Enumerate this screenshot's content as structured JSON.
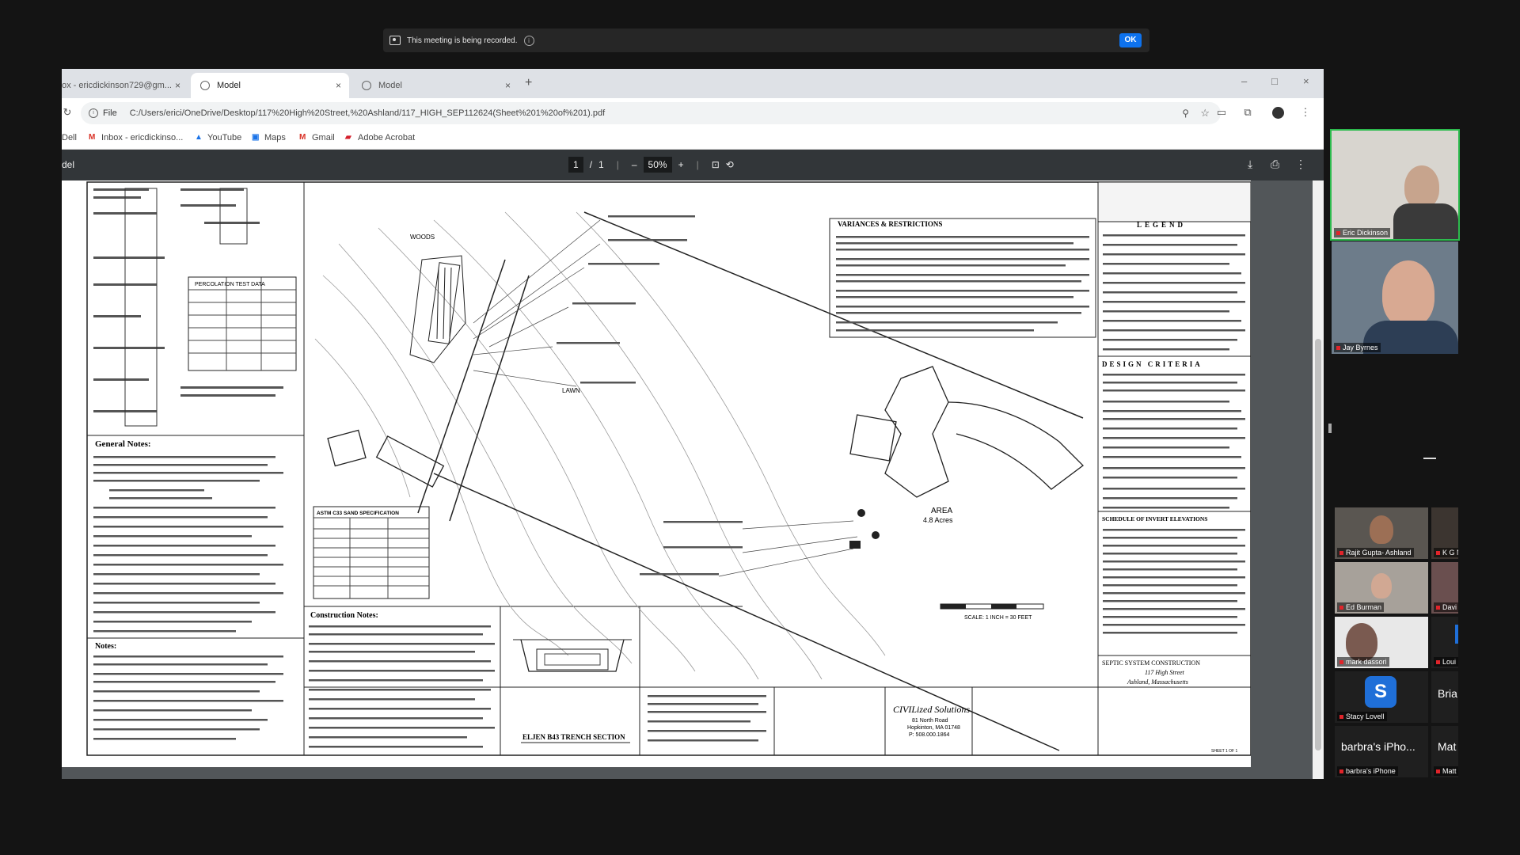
{
  "recording_banner": {
    "text": "This meeting is being recorded.",
    "info": "i",
    "ok_label": "OK"
  },
  "browser": {
    "tabs": [
      {
        "label": "ox - ericdickinson729@gm...",
        "close": "×"
      },
      {
        "label": "Model",
        "close": "×"
      },
      {
        "label": "Model",
        "close": "×"
      }
    ],
    "new_tab": "+",
    "window_controls": {
      "minimize": "–",
      "maximize": "□",
      "close": "×"
    },
    "address": {
      "scheme_label": "File",
      "url": "C:/Users/erici/OneDrive/Desktop/117%20High%20Street,%20Ashland/117_HIGH_SEP112624(Sheet%201%20of%201).pdf"
    },
    "bookmarks": [
      {
        "label": "Dell"
      },
      {
        "label": "Inbox - ericdickinso..."
      },
      {
        "label": "YouTube"
      },
      {
        "label": "Maps"
      },
      {
        "label": "Gmail"
      },
      {
        "label": "Adobe Acrobat"
      }
    ]
  },
  "pdf_viewer": {
    "title": "del",
    "page_current": "1",
    "page_separator": "/",
    "page_total": "1",
    "zoom": "50%",
    "zoom_out": "–",
    "zoom_in": "+"
  },
  "drawing": {
    "general_notes_title": "General Notes:",
    "notes_title": "Notes:",
    "construction_notes_title": "Construction Notes:",
    "astm_title": "ASTM C33 SAND SPECIFICATION",
    "variances_title": "VARIANCES & RESTRICTIONS",
    "legend_title": "LEGEND",
    "design_criteria_title": "DESIGN CRITERIA",
    "trench_section_title": "ELJEN B43 TRENCH SECTION",
    "area_label": "AREA",
    "area_value": "4.8 Acres",
    "lawn_label": "LAWN",
    "woods_label": "WOODS",
    "scale_label": "SCALE: 1 INCH = 30 FEET",
    "firm_name": "CIVILized Solutions",
    "firm_address_1": "81 North Road",
    "firm_address_2": "Hopkinton, MA 01748",
    "firm_phone": "P: 508.000.1864",
    "project_title": "SEPTIC SYSTEM CONSTRUCTION",
    "project_address_1": "117 High Street",
    "project_address_2": "Ashland, Massachusetts",
    "sheet_label": "SHEET 1 OF 1",
    "percolation_title": "PERCOLATION TEST DATA",
    "invert_title": "SCHEDULE OF INVERT ELEVATIONS"
  },
  "participants": [
    {
      "name": "Eric Dickinson"
    },
    {
      "name": "Jay Byrnes"
    },
    {
      "name": "Rajit Gupta- Ashland"
    },
    {
      "name": "K G Ne"
    },
    {
      "name": "Ed Burman"
    },
    {
      "name": "Davi"
    },
    {
      "name": "mark dassori"
    },
    {
      "name": "Loui"
    },
    {
      "name": "Stacy Lovell",
      "initial": "S"
    },
    {
      "name": "Bria"
    },
    {
      "name": "barbra's iPho..."
    },
    {
      "name": "Mat"
    },
    {
      "name": "barbra's iPhone"
    },
    {
      "name": "Matt"
    }
  ],
  "colors": {
    "zoom_ok": "#0e72ed",
    "pdf_toolbar": "#323639",
    "active_speaker": "#2dbb4e",
    "avatar_blue": "#1f6fd8"
  }
}
